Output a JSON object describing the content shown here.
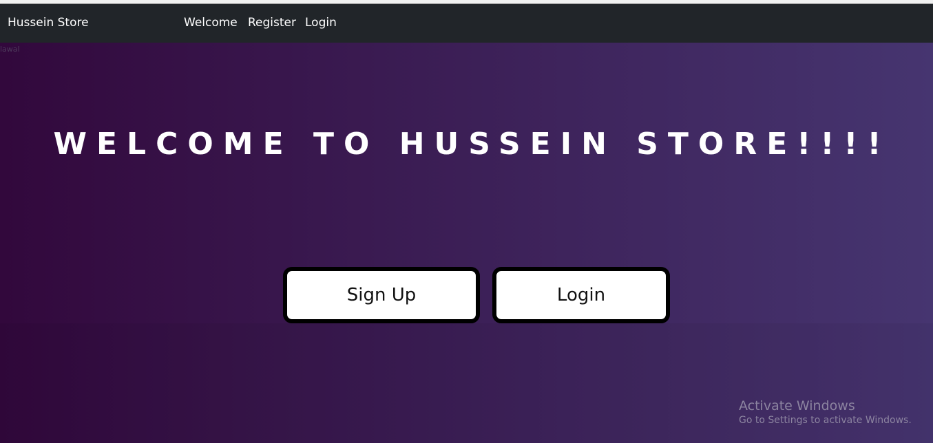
{
  "navbar": {
    "brand": "Hussein Store",
    "links": [
      "Welcome",
      "Register",
      "Login"
    ]
  },
  "main": {
    "corner_text": "lawal",
    "title": "WELCOME TO HUSSEIN STORE!!!!",
    "buttons": {
      "signup": "Sign Up",
      "login": "Login"
    }
  },
  "watermark": {
    "title": "Activate Windows",
    "subtitle": "Go to Settings to activate Windows."
  },
  "colors": {
    "navbar_bg": "#212529",
    "gradient_left": "#32083c",
    "gradient_right": "#463570",
    "button_bg": "#ffffff",
    "button_border": "#000000"
  }
}
